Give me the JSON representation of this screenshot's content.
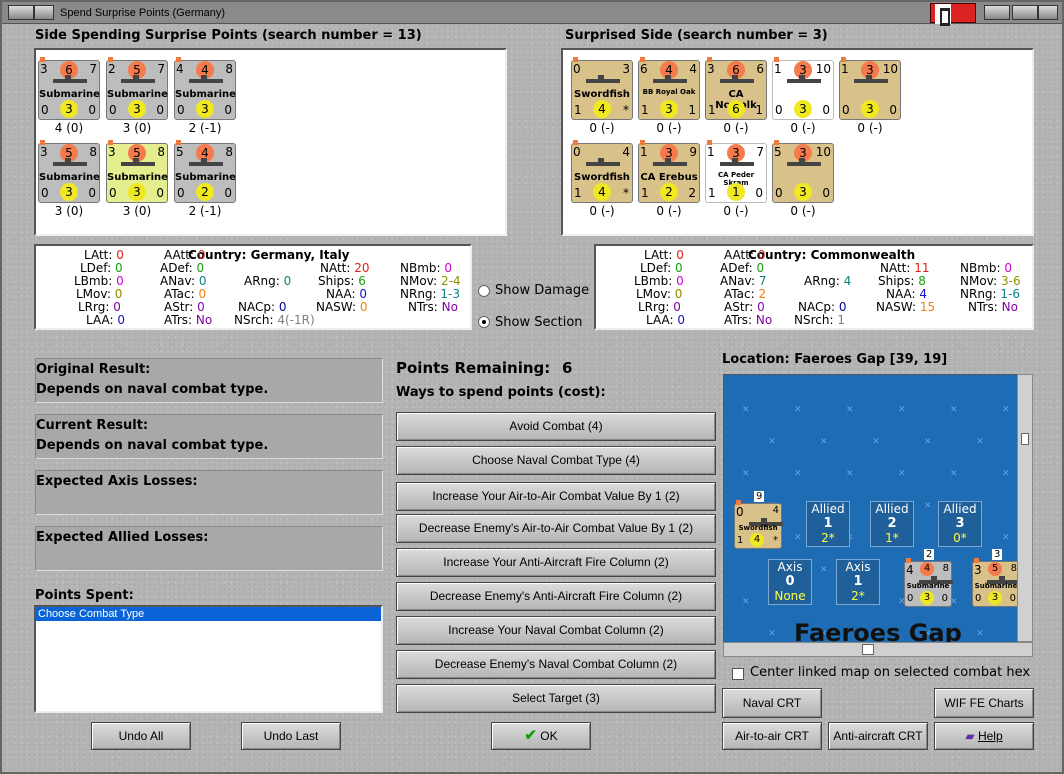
{
  "window": {
    "title": "Spend Surprise Points (Germany)"
  },
  "headers": {
    "spending": "Side Spending Surprise Points (search number = 13)",
    "surprised": "Surprised Side (search number = 3)"
  },
  "spending_units": [
    {
      "tl": "3",
      "tm": "6",
      "tr": "7",
      "name": "Submarine",
      "bl": "0",
      "bm": "3",
      "br": "0",
      "under": "4 (0)",
      "style": "gray"
    },
    {
      "tl": "2",
      "tm": "5",
      "tr": "7",
      "name": "Submarine",
      "bl": "0",
      "bm": "3",
      "br": "0",
      "under": "3 (0)",
      "style": "gray"
    },
    {
      "tl": "4",
      "tm": "4",
      "tr": "8",
      "name": "Submarine",
      "bl": "0",
      "bm": "3",
      "br": "0",
      "under": "2 (-1)",
      "style": "gray"
    },
    {
      "tl": "3",
      "tm": "5",
      "tr": "8",
      "name": "Submarine",
      "bl": "0",
      "bm": "3",
      "br": "0",
      "under": "3 (0)",
      "style": "gray"
    },
    {
      "tl": "3",
      "tm": "5",
      "tr": "8",
      "name": "Submarine",
      "bl": "0",
      "bm": "3",
      "br": "0",
      "under": "3 (0)",
      "style": "yellow"
    },
    {
      "tl": "5",
      "tm": "4",
      "tr": "8",
      "name": "Submarine",
      "bl": "0",
      "bm": "2",
      "br": "0",
      "under": "2 (-1)",
      "style": "gray"
    }
  ],
  "surprised_units": [
    {
      "tl": "0",
      "tm": "",
      "tr": "3",
      "name": "Swordfish",
      "bl": "1",
      "bm": "4",
      "br": "*",
      "under": "0 (-)",
      "style": "tan"
    },
    {
      "tl": "6",
      "tm": "4",
      "tr": "4",
      "name": "BB Royal Oak",
      "bl": "1",
      "bm": "3",
      "br": "1",
      "under": "0 (-)",
      "style": "tan"
    },
    {
      "tl": "3",
      "tm": "6",
      "tr": "6",
      "name": "CA Norfolk",
      "bl": "1",
      "bm": "6",
      "br": "1",
      "under": "0 (-)",
      "style": "tan"
    },
    {
      "tl": "1",
      "tm": "3",
      "tr": "10",
      "name": "",
      "bl": "0",
      "bm": "3",
      "br": "0",
      "under": "0 (-)",
      "style": "white"
    },
    {
      "tl": "1",
      "tm": "3",
      "tr": "10",
      "name": "",
      "bl": "0",
      "bm": "3",
      "br": "0",
      "under": "0 (-)",
      "style": "tan"
    },
    {
      "tl": "0",
      "tm": "",
      "tr": "4",
      "name": "Swordfish",
      "bl": "1",
      "bm": "4",
      "br": "*",
      "under": "0 (-)",
      "style": "tan"
    },
    {
      "tl": "1",
      "tm": "3",
      "tr": "9",
      "name": "CA Erebus",
      "bl": "1",
      "bm": "2",
      "br": "2",
      "under": "0 (-)",
      "style": "tan"
    },
    {
      "tl": "1",
      "tm": "3",
      "tr": "7",
      "name": "CA Peder Skram",
      "bl": "1",
      "bm": "1",
      "br": "0",
      "under": "0 (-)",
      "style": "white"
    },
    {
      "tl": "5",
      "tm": "3",
      "tr": "10",
      "name": "",
      "bl": "0",
      "bm": "3",
      "br": "0",
      "under": "0 (-)",
      "style": "tan"
    }
  ],
  "axis_stats": {
    "country_label": "Country: Germany, Italy",
    "LAtt": "0",
    "LDef": "0",
    "LBmb": "0",
    "LMov": "0",
    "LRrg": "0",
    "LAA": "0",
    "AAtt": "0",
    "ADef": "0",
    "ANav": "0",
    "ATac": "0",
    "AStr": "0",
    "ATrs": "No",
    "ARng": "0",
    "NACp": "0",
    "NSrch": "4(-1R)",
    "NAtt": "20",
    "Ships": "6",
    "NAA": "0",
    "NASW": "0",
    "NBmb": "0",
    "NMov": "2-4",
    "NRng": "1-3",
    "NTrs": "No"
  },
  "allied_stats": {
    "country_label": "Country: Commonwealth",
    "LAtt": "0",
    "LDef": "0",
    "LBmb": "0",
    "LMov": "0",
    "LRrg": "0",
    "LAA": "0",
    "AAtt": "0",
    "ADef": "0",
    "ANav": "7",
    "ATac": "2",
    "AStr": "0",
    "ATrs": "No",
    "ARng": "4",
    "NACp": "0",
    "NSrch": "1",
    "NAtt": "11",
    "Ships": "8",
    "NAA": "4",
    "NASW": "15",
    "NBmb": "0",
    "NMov": "3-6",
    "NRng": "1-6",
    "NTrs": "No"
  },
  "stat_labels": {
    "LAtt": "LAtt:",
    "LDef": "LDef:",
    "LBmb": "LBmb:",
    "LMov": "LMov:",
    "LRrg": "LRrg:",
    "LAA": "LAA:",
    "AAtt": "AAtt:",
    "ADef": "ADef:",
    "ANav": "ANav:",
    "ATac": "ATac:",
    "AStr": "AStr:",
    "ATrs": "ATrs:",
    "ARng": "ARng:",
    "NACp": "NACp:",
    "NSrch": "NSrch:",
    "NAtt": "NAtt:",
    "Ships": "Ships:",
    "NAA": "NAA:",
    "NASW": "NASW:",
    "NBmb": "NBmb:",
    "NMov": "NMov:",
    "NRng": "NRng:",
    "NTrs": "NTrs:"
  },
  "options": {
    "show_damage": "Show Damage",
    "show_section": "Show Section",
    "selected": "show_section"
  },
  "results": {
    "original_label": "Original Result:",
    "original_value": "Depends on naval combat type.",
    "current_label": "Current Result:",
    "current_value": "Depends on naval combat type.",
    "axis_losses_label": "Expected Axis Losses:",
    "allied_losses_label": "Expected Allied Losses:"
  },
  "points_spent": {
    "label": "Points Spent:",
    "items": [
      "Choose Combat Type"
    ]
  },
  "points": {
    "remaining_label": "Points Remaining:",
    "remaining_value": "6",
    "ways_label": "Ways to spend points (cost):"
  },
  "spend_buttons": [
    "Avoid Combat (4)",
    "Choose Naval Combat Type (4)",
    "Increase Your Air-to-Air Combat Value By 1 (2)",
    "Decrease Enemy's Air-to-Air Combat Value By 1 (2)",
    "Increase Your Anti-Aircraft Fire Column (2)",
    "Decrease Enemy's Anti-Aircraft Fire Column (2)",
    "Increase Your Naval Combat Column (2)",
    "Decrease Enemy's Naval Combat Column (2)",
    "Select Target (3)"
  ],
  "map": {
    "location_label": "Location: Faeroes Gap [39, 19]",
    "name": "Faeroes Gap",
    "allied_boxes": [
      {
        "label": "Allied",
        "value": "1",
        "sub": "2*"
      },
      {
        "label": "Allied",
        "value": "2",
        "sub": "1*"
      },
      {
        "label": "Allied",
        "value": "3",
        "sub": "0*"
      }
    ],
    "axis_boxes": [
      {
        "label": "Axis",
        "value": "0",
        "sub": "None"
      },
      {
        "label": "Axis",
        "value": "1",
        "sub": "2*"
      }
    ],
    "stack_counts": [
      "9",
      "2",
      "3"
    ],
    "mini_units": [
      {
        "tl": "0",
        "tr": "4",
        "name": "Swordfish",
        "bl": "1",
        "bm": "4",
        "br": "*"
      },
      {
        "tl": "4",
        "tm": "4",
        "tr": "8",
        "name": "Submarine",
        "bl": "0",
        "bm": "3",
        "br": "0"
      },
      {
        "tl": "3",
        "tm": "5",
        "tr": "8",
        "name": "Submarine",
        "bl": "0",
        "bm": "3",
        "br": "0"
      }
    ],
    "center_checkbox_label": "Center linked map on selected combat hex"
  },
  "bottom_buttons": {
    "undo_all": "Undo All",
    "undo_last": "Undo Last",
    "ok": "OK",
    "naval_crt": "Naval CRT",
    "wif_fe_charts": "WIF FE Charts",
    "air_to_air_crt": "Air-to-air CRT",
    "anti_aircraft_crt": "Anti-aircraft CRT",
    "help": "Help"
  },
  "colors": {
    "accent_select": "#0a64d8",
    "map_sea": "#1e6cb4",
    "ok_check": "#10a010"
  }
}
